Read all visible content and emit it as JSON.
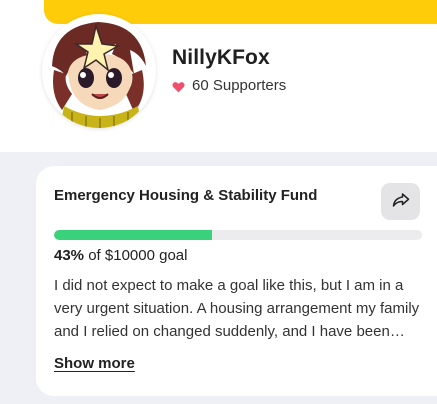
{
  "profile": {
    "name": "NillyKFox",
    "supporters": "60 Supporters"
  },
  "goal": {
    "title": "Emergency Housing & Stability Fund",
    "progress_fraction": 0.43,
    "percent_label": "43%",
    "goal_text": "of $10000 goal",
    "description": "I did not expect to make a goal like this, but I am in a very urgent situation. A housing arrangement my family and I relied on changed suddenly, and I have been doing everything I can to stay afloat.",
    "show_more_label": "Show more"
  },
  "colors": {
    "banner": "#ffcc0a",
    "progress": "#3ad17b",
    "heart": "#f0506e"
  },
  "icons": {
    "heart": "heart-icon",
    "share": "share-icon"
  }
}
